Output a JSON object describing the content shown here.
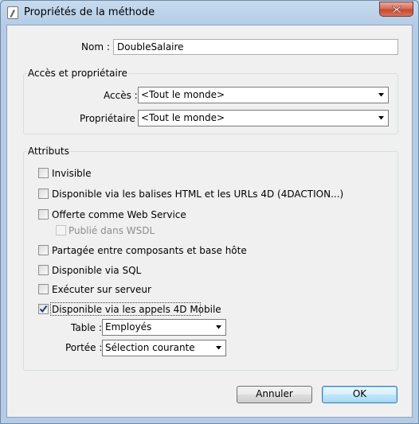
{
  "window": {
    "title": "Propriétés de la méthode",
    "icon": "method-document-icon",
    "close_icon": "close-x-icon"
  },
  "name_field": {
    "label": "Nom :",
    "value": "DoubleSalaire"
  },
  "access_group": {
    "title": "Accès et propriétaire",
    "access_label": "Accès :",
    "access_value": "<Tout le monde>",
    "owner_label": "Propriétaire :",
    "owner_value": "<Tout le monde>"
  },
  "attributes_group": {
    "title": "Attributs",
    "options": {
      "invisible": {
        "label": "Invisible",
        "checked": false
      },
      "html_tags": {
        "label": "Disponible via les balises HTML et les URLs 4D (4DACTION...)",
        "checked": false
      },
      "web_service": {
        "label": "Offerte comme Web Service",
        "checked": false
      },
      "wsdl": {
        "label": "Publié dans WSDL",
        "checked": false,
        "enabled": false
      },
      "shared": {
        "label": "Partagée entre composants et base hôte",
        "checked": false
      },
      "sql": {
        "label": "Disponible via SQL",
        "checked": false
      },
      "server": {
        "label": "Exécuter sur serveur",
        "checked": false
      },
      "mobile": {
        "label": "Disponible via les appels 4D Mobile",
        "checked": true
      }
    },
    "table_label": "Table :",
    "table_value": "Employés",
    "scope_label": "Portée :",
    "scope_value": "Sélection courante"
  },
  "buttons": {
    "cancel": "Annuler",
    "ok": "OK"
  },
  "colors": {
    "frame": "#b4cce6",
    "client_bg": "#f0f0f0",
    "close_button": "#c44a32",
    "default_button_border": "#3c7fb1"
  }
}
